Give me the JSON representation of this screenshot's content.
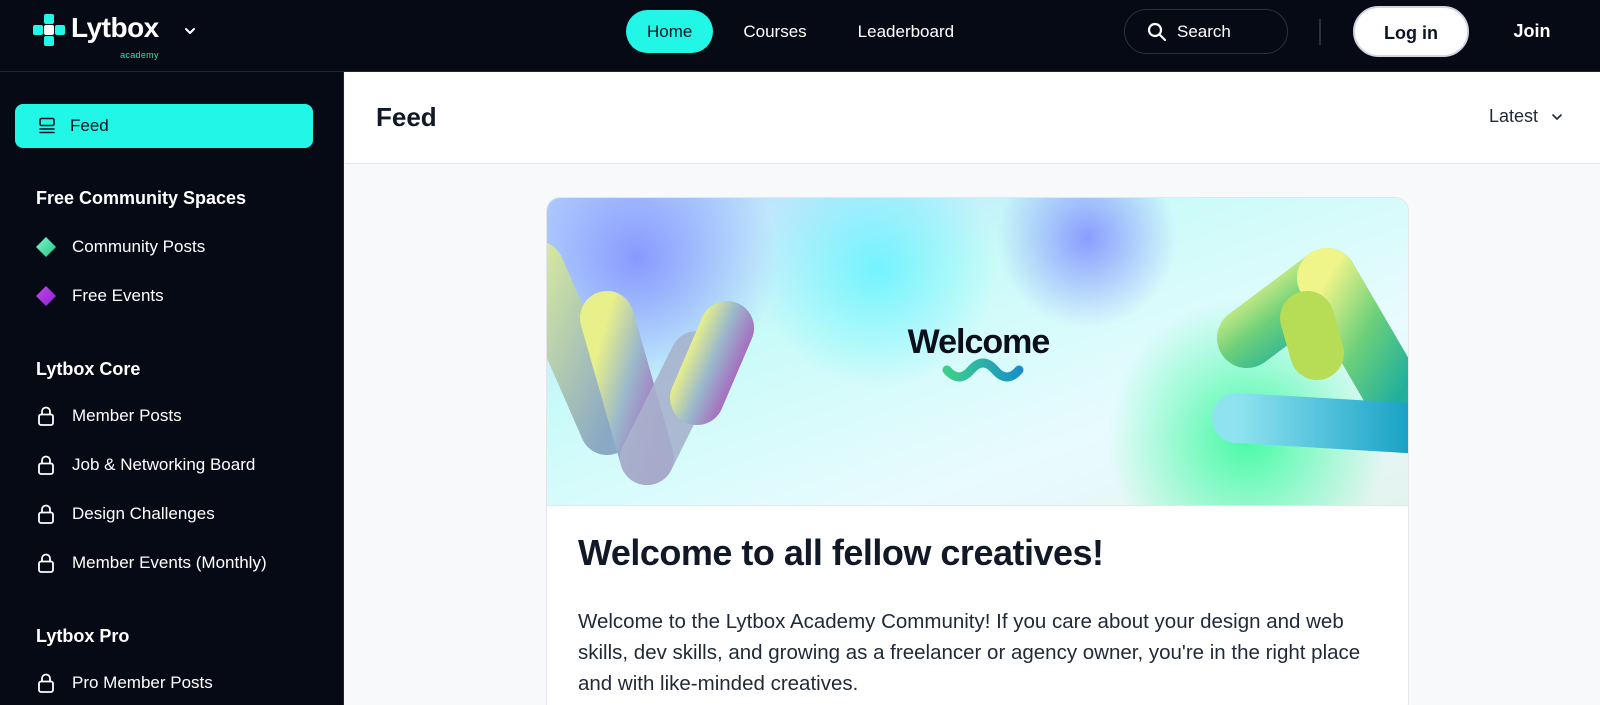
{
  "brand": {
    "name": "Lytbox",
    "sub": "academy",
    "accent": "#22f6e6",
    "green": "#2ee6a6"
  },
  "nav": {
    "items": [
      {
        "label": "Home",
        "active": true
      },
      {
        "label": "Courses"
      },
      {
        "label": "Leaderboard"
      }
    ]
  },
  "search": {
    "placeholder": "Search"
  },
  "auth": {
    "login": "Log in",
    "join": "Join"
  },
  "sidebar": {
    "feed_label": "Feed",
    "sections": [
      {
        "title": "Free Community Spaces",
        "items": [
          {
            "label": "Community Posts",
            "icon": "diamond-green-icon"
          },
          {
            "label": "Free Events",
            "icon": "diamond-purple-icon"
          }
        ]
      },
      {
        "title": "Lytbox Core",
        "items": [
          {
            "label": "Member Posts",
            "icon": "lock-icon"
          },
          {
            "label": "Job & Networking Board",
            "icon": "lock-icon"
          },
          {
            "label": "Design Challenges",
            "icon": "lock-icon"
          },
          {
            "label": "Member Events (Monthly)",
            "icon": "lock-icon"
          }
        ]
      },
      {
        "title": "Lytbox Pro",
        "items": [
          {
            "label": "Pro Member Posts",
            "icon": "lock-icon"
          }
        ]
      }
    ]
  },
  "main": {
    "title": "Feed",
    "sort_label": "Latest",
    "post": {
      "banner_text": "Welcome",
      "title": "Welcome to all fellow creatives!",
      "body": "Welcome to the Lytbox Academy Community! If you care about your design and web skills, dev skills, and growing as a freelancer or agency owner, you're in the right place and with like-minded creatives."
    }
  }
}
